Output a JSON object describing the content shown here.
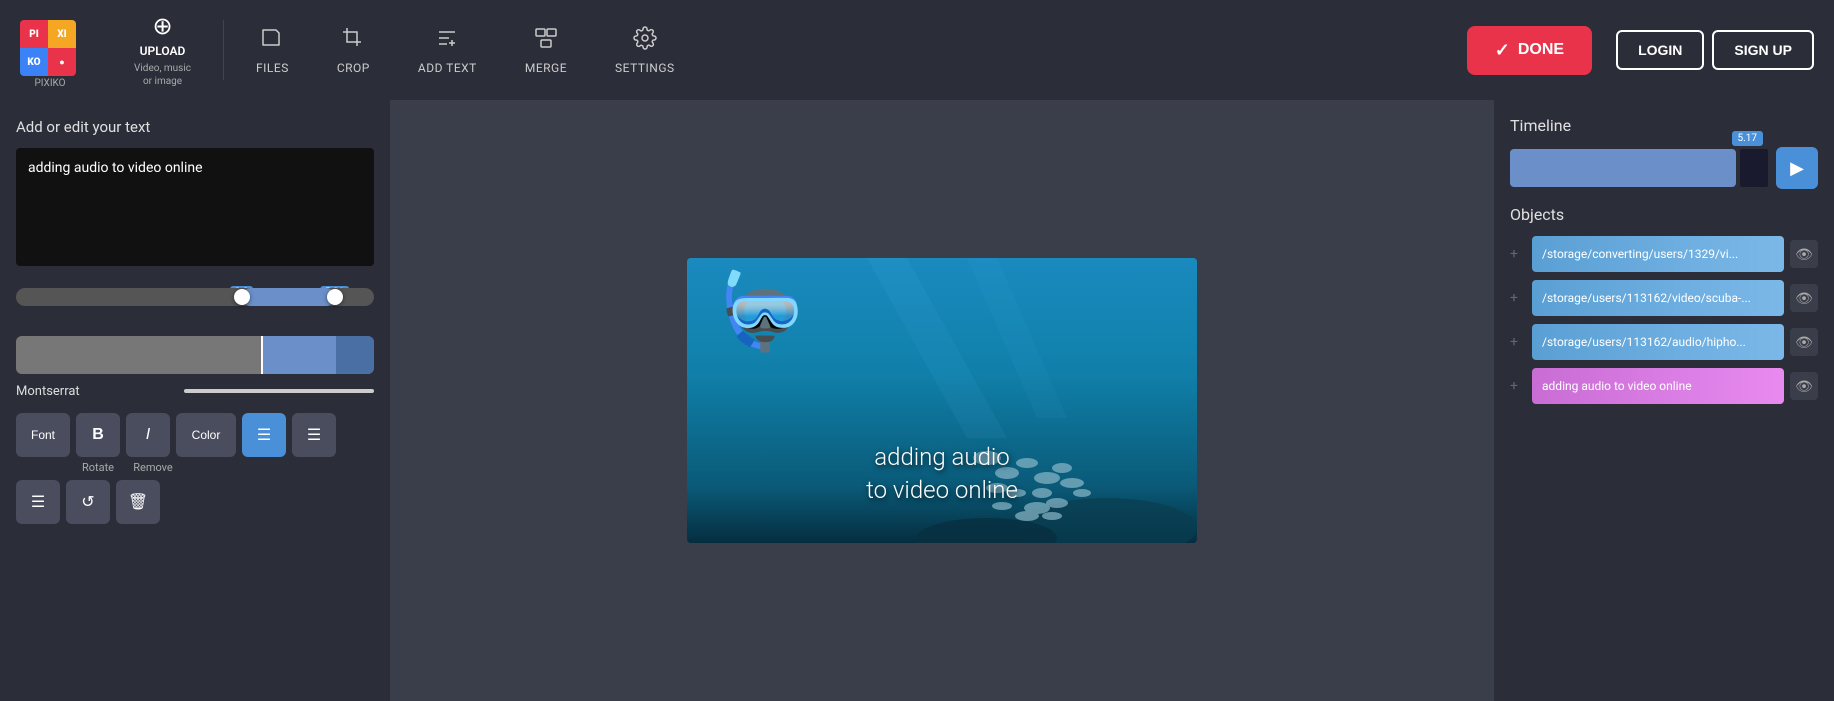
{
  "logo": {
    "alt": "Pixiko",
    "subtext": "PIXIKO"
  },
  "nav": {
    "upload_label": "UPLOAD",
    "upload_sublabel": "Video, music\nor image",
    "files_label": "FILES",
    "crop_label": "CROP",
    "add_text_label": "ADD TEXT",
    "merge_label": "MERGE",
    "settings_label": "SETTINGS",
    "done_label": "DONE",
    "login_label": "LOGIN",
    "signup_label": "SIGN UP"
  },
  "left_panel": {
    "title": "Add or edit your text",
    "text_value": "adding audio to video online",
    "slider_left": "3.9",
    "slider_right": "5.91",
    "font_name": "Montserrat",
    "bold_label": "B",
    "italic_label": "I",
    "color_label": "Color",
    "align_left_label": "≡",
    "align_right_label": "≡",
    "rotate_label": "Rotate",
    "remove_label": "Remove",
    "font_label": "Font"
  },
  "video": {
    "overlay_line1": "adding audio",
    "overlay_line2": "to video online"
  },
  "right_panel": {
    "timeline_title": "Timeline",
    "timeline_marker": "5.17",
    "objects_title": "Objects",
    "objects": [
      {
        "label": "/storage/converting/users/1329/vi...",
        "color": "blue"
      },
      {
        "label": "/storage/users/113162/video/scuba-...",
        "color": "blue"
      },
      {
        "label": "/storage/users/113162/audio/hipho...",
        "color": "blue"
      },
      {
        "label": "adding audio to video online",
        "color": "pink"
      }
    ]
  }
}
